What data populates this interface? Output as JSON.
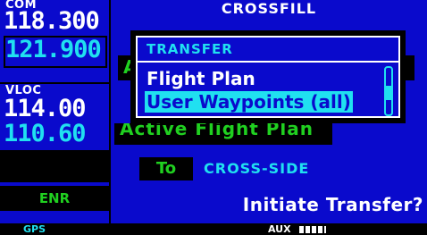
{
  "left_panel": {
    "com_label": "COM",
    "com_active": "118.300",
    "com_standby": "121.900",
    "vloc_label": "VLOC",
    "vloc_active": "114.00",
    "vloc_standby": "110.60",
    "mode": "ENR"
  },
  "main": {
    "title": "CROSSFILL",
    "hidden_field_letter": "A",
    "field_text": "Active Flight Plan",
    "to_label": "To",
    "destination": "CROSS-SIDE",
    "prompt": "Initiate Transfer?"
  },
  "popup": {
    "title": "TRANSFER",
    "items": [
      "Flight Plan",
      "User Waypoints (all)"
    ],
    "selected_index": 1
  },
  "status_bar": {
    "gps": "GPS",
    "aux": "AUX"
  }
}
